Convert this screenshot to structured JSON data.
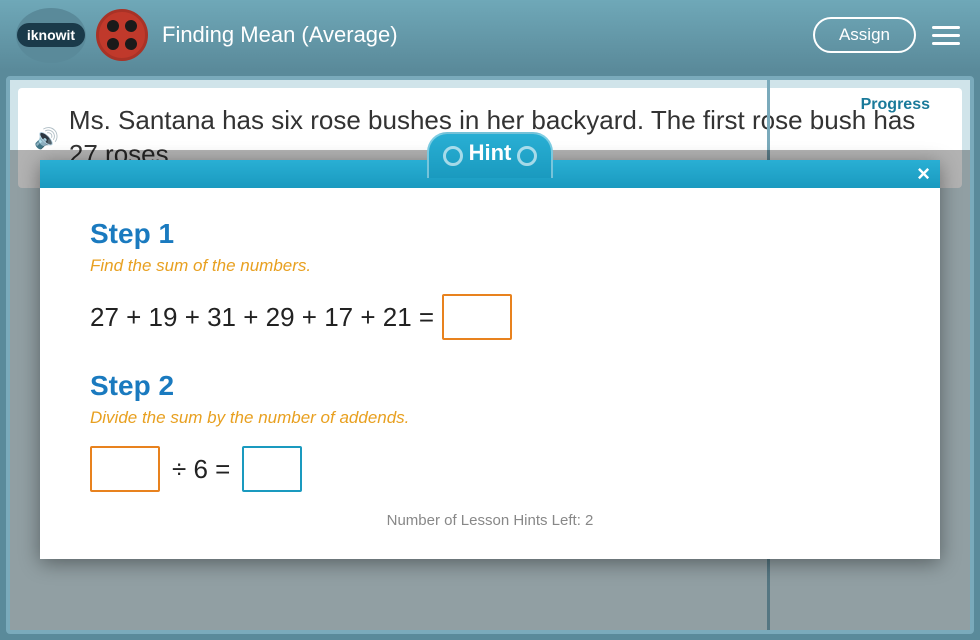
{
  "header": {
    "logo_text": "iknowit",
    "lesson_title": "Finding Mean (Average)",
    "assign_label": "Assign"
  },
  "background": {
    "question_prefix": "Ms. Santana has six rose bushes in her backyard. The first rose bush has 27 roses",
    "progress_label": "Progress"
  },
  "modal": {
    "hint_tab_label": "Hint",
    "close_label": "×",
    "step1": {
      "title": "Step 1",
      "description": "Find the sum of the numbers.",
      "equation": "27 + 19 + 31 + 29 + 17 + 21 ="
    },
    "step2": {
      "title": "Step 2",
      "description": "Divide the sum by the number of addends.",
      "divisor": "÷ 6 ="
    },
    "hints_left_label": "Number of Lesson Hints Left: 2"
  }
}
